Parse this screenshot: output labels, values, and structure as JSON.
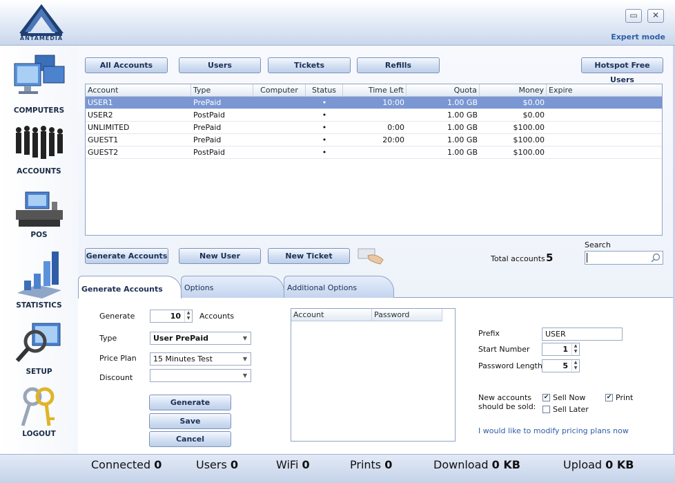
{
  "window": {
    "logo_text": "ANTAMEDIA",
    "minimize_glyph": "▭",
    "close_glyph": "✕",
    "expert_mode": "Expert mode"
  },
  "nav": [
    {
      "label": "COMPUTERS",
      "icon": "computers-icon"
    },
    {
      "label": "ACCOUNTS",
      "icon": "people-icon"
    },
    {
      "label": "POS",
      "icon": "cash-register-icon"
    },
    {
      "label": "STATISTICS",
      "icon": "bar-chart-icon"
    },
    {
      "label": "SETUP",
      "icon": "magnifier-monitor-icon"
    },
    {
      "label": "LOGOUT",
      "icon": "keys-icon"
    }
  ],
  "top_buttons": {
    "all_accounts": "All Accounts",
    "users": "Users",
    "tickets": "Tickets",
    "refills": "Refills",
    "hotspot": "Hotspot Free Users"
  },
  "accounts_table": {
    "columns": [
      "Account",
      "Type",
      "Computer",
      "Status",
      "Time Left",
      "Quota",
      "Money",
      "Expire"
    ],
    "rows": [
      {
        "account": "USER1",
        "type": "PrePaid",
        "computer": "",
        "status": "•",
        "time_left": "10:00",
        "quota": "1.00 GB",
        "money": "$0.00",
        "expire": "",
        "selected": true
      },
      {
        "account": "USER2",
        "type": "PostPaid",
        "computer": "",
        "status": "•",
        "time_left": "",
        "quota": "1.00 GB",
        "money": "$0.00",
        "expire": ""
      },
      {
        "account": "UNLIMITED",
        "type": "PrePaid",
        "computer": "",
        "status": "•",
        "time_left": "0:00",
        "quota": "1.00 GB",
        "money": "$100.00",
        "expire": ""
      },
      {
        "account": "GUEST1",
        "type": "PrePaid",
        "computer": "",
        "status": "•",
        "time_left": "20:00",
        "quota": "1.00 GB",
        "money": "$100.00",
        "expire": ""
      },
      {
        "account": "GUEST2",
        "type": "PostPaid",
        "computer": "",
        "status": "•",
        "time_left": "",
        "quota": "1.00 GB",
        "money": "$100.00",
        "expire": ""
      }
    ]
  },
  "action_buttons": {
    "generate_accounts": "Generate Accounts",
    "new_user": "New User",
    "new_ticket": "New Ticket"
  },
  "summary": {
    "total_label": "Total accounts",
    "total_value": "5",
    "search_label": "Search",
    "search_value": ""
  },
  "tabs": [
    "Generate Accounts",
    "Options",
    "Additional Options"
  ],
  "generate_form": {
    "generate_label": "Generate",
    "generate_count": "10",
    "accounts_label": "Accounts",
    "type_label": "Type",
    "type_value": "User PrePaid",
    "price_plan_label": "Price Plan",
    "price_plan_value": "15 Minutes Test",
    "discount_label": "Discount",
    "discount_value": "",
    "generate_btn": "Generate",
    "save_btn": "Save",
    "cancel_btn": "Cancel"
  },
  "generated_list": {
    "col_account": "Account",
    "col_password": "Password"
  },
  "right_form": {
    "prefix_label": "Prefix",
    "prefix_value": "USER",
    "start_label": "Start Number",
    "start_value": "1",
    "pwlen_label": "Password Length",
    "pwlen_value": "5",
    "sold_label_1": "New accounts",
    "sold_label_2": "should be sold:",
    "sell_now": "Sell Now",
    "sell_now_checked": true,
    "sell_later": "Sell Later",
    "sell_later_checked": false,
    "print": "Print",
    "print_checked": true,
    "modify_link": "I would like to modify pricing plans now"
  },
  "status": {
    "connected_label": "Connected",
    "connected": "0",
    "users_label": "Users",
    "users": "0",
    "wifi_label": "WiFi",
    "wifi": "0",
    "prints_label": "Prints",
    "prints": "0",
    "download_label": "Download",
    "download": "0 KB",
    "upload_label": "Upload",
    "upload": "0 KB"
  }
}
